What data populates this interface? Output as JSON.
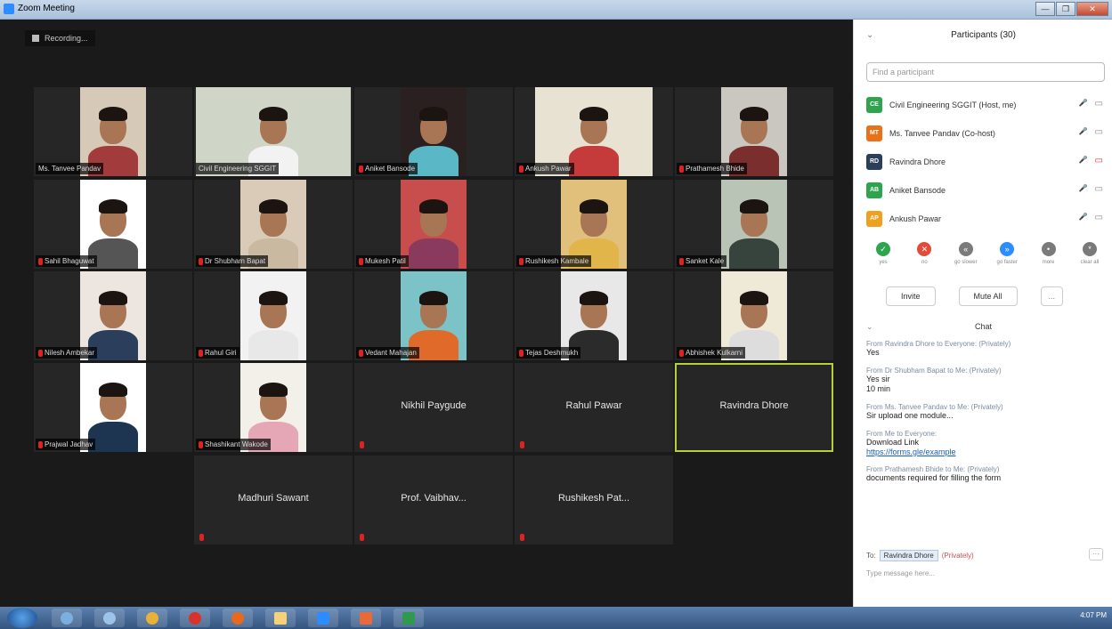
{
  "window": {
    "title": "Zoom Meeting",
    "controls": [
      "—",
      "❐",
      "✕"
    ]
  },
  "recording": {
    "label": "Recording..."
  },
  "tiles": [
    {
      "id": "t1",
      "name": "Ms. Tanvee Pandav",
      "mic": false,
      "video": true
    },
    {
      "id": "t2",
      "name": "Civil Engineering SGGIT",
      "mic": false,
      "video": true
    },
    {
      "id": "t3",
      "name": "Aniket Bansode",
      "mic": true,
      "video": true
    },
    {
      "id": "t4",
      "name": "Ankush Pawar",
      "mic": true,
      "video": true
    },
    {
      "id": "t5",
      "name": "Prathamesh Bhide",
      "mic": true,
      "video": true
    },
    {
      "id": "t6",
      "name": "Sahil Bhaguwat",
      "mic": true,
      "video": true
    },
    {
      "id": "t7",
      "name": "Dr Shubham Bapat",
      "mic": true,
      "video": true
    },
    {
      "id": "t8",
      "name": "Mukesh Patil",
      "mic": true,
      "video": true
    },
    {
      "id": "t9",
      "name": "Rushikesh Kambale",
      "mic": true,
      "video": true
    },
    {
      "id": "t10",
      "name": "Sanket Kale",
      "mic": true,
      "video": true
    },
    {
      "id": "t11",
      "name": "Nilesh Ambekar",
      "mic": true,
      "video": true
    },
    {
      "id": "t12",
      "name": "Rahul Giri",
      "mic": true,
      "video": true
    },
    {
      "id": "t13",
      "name": "Vedant Mahajan",
      "mic": true,
      "video": true
    },
    {
      "id": "t14",
      "name": "Tejas Deshmukh",
      "mic": true,
      "video": true
    },
    {
      "id": "t15",
      "name": "Abhishek Kulkarni",
      "mic": true,
      "video": true
    },
    {
      "id": "t16",
      "name": "Prajwal Jadhav",
      "mic": true,
      "video": true
    },
    {
      "id": "t17",
      "name": "Shashikant Wakode",
      "mic": true,
      "video": true
    },
    {
      "id": "t18",
      "name": "Nikhil Paygude",
      "mic": true,
      "video": false
    },
    {
      "id": "t19",
      "name": "Rahul Pawar",
      "mic": true,
      "video": false
    },
    {
      "id": "t20",
      "name": "Ravindra Dhore",
      "mic": false,
      "video": false,
      "active": true
    },
    {
      "id": "t21",
      "name": "Madhuri Sawant",
      "mic": true,
      "video": false
    },
    {
      "id": "t22",
      "name": "Prof. Vaibhav...",
      "mic": true,
      "video": false
    },
    {
      "id": "t23",
      "name": "Rushikesh Pat...",
      "mic": true,
      "video": false
    }
  ],
  "participants_panel": {
    "title": "Participants (30)",
    "search_placeholder": "Find a participant",
    "people": [
      {
        "initials": "CE",
        "name": "Civil Engineering SGGIT (Host, me)",
        "color": "#2ea44f"
      },
      {
        "initials": "MT",
        "name": "Ms. Tanvee Pandav (Co-host)",
        "color": "#e8711a"
      },
      {
        "initials": "RD",
        "name": "Ravindra Dhore",
        "color": "#2b3f5c"
      },
      {
        "initials": "AB",
        "name": "Aniket Bansode",
        "color": "#2ea44f"
      },
      {
        "initials": "AP",
        "name": "Ankush Pawar",
        "color": "#f0a020"
      }
    ],
    "reactions": [
      {
        "label": "yes",
        "color": "#2ea44f",
        "glyph": "✓"
      },
      {
        "label": "no",
        "color": "#e04b3b",
        "glyph": "✕"
      },
      {
        "label": "go slower",
        "color": "#7a7a7a",
        "glyph": "«"
      },
      {
        "label": "go faster",
        "color": "#2d8cff",
        "glyph": "»"
      },
      {
        "label": "more",
        "color": "#7a7a7a",
        "glyph": "•"
      },
      {
        "label": "clear all",
        "color": "#7a7a7a",
        "glyph": "*"
      }
    ],
    "invite_label": "Invite",
    "mute_all_label": "Mute All",
    "more_label": "..."
  },
  "chat": {
    "title": "Chat",
    "messages": [
      {
        "from": "From Ravindra Dhore to Everyone: (Privately)",
        "text": "Yes"
      },
      {
        "from": "From Dr Shubham Bapat to Me: (Privately)",
        "text": "Yes sir\n10 min"
      },
      {
        "from": "From Ms. Tanvee Pandav to Me: (Privately)",
        "text": "Sir upload one module..."
      },
      {
        "from": "From Me to Everyone:",
        "text": "Download Link",
        "link": "https://forms.gle/example"
      },
      {
        "from": "From Prathamesh Bhide to Me: (Privately)",
        "text": "documents required for filling the form"
      }
    ],
    "to_label": "To:",
    "recipient": "Ravindra Dhore",
    "privately": "(Privately)",
    "placeholder": "Type message here..."
  },
  "taskbar": {
    "time": "4:07 PM"
  }
}
